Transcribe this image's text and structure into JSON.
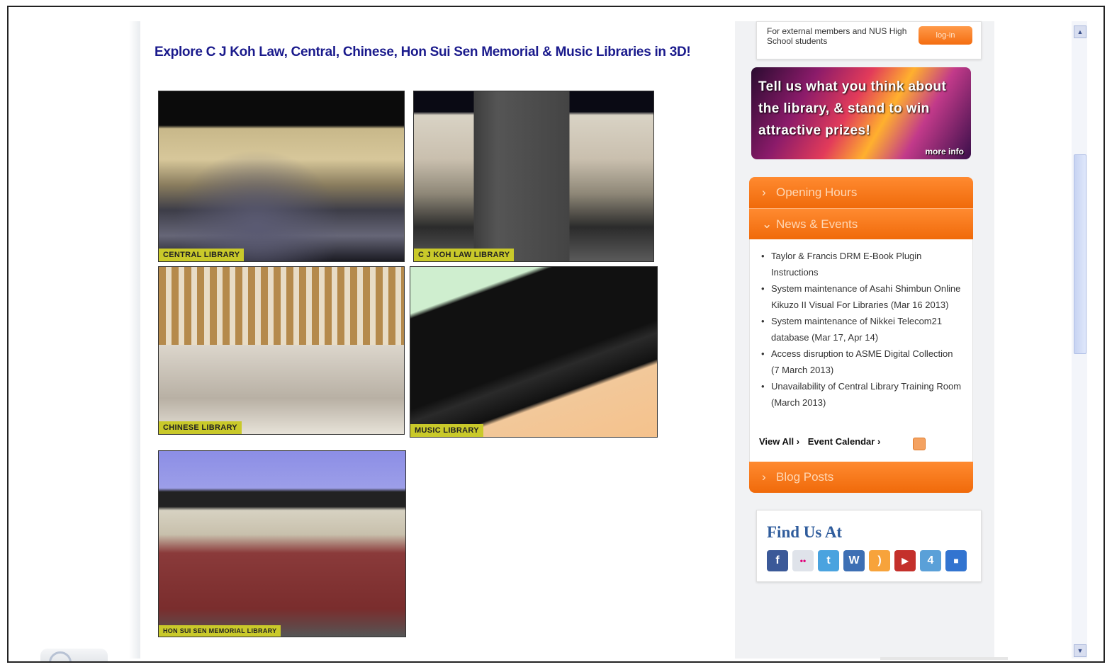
{
  "main": {
    "heading": "Explore C J Koh Law, Central, Chinese, Hon Sui Sen Memorial & Music Libraries in 3D!",
    "tiles": [
      {
        "label": "CENTRAL LIBRARY"
      },
      {
        "label": "C J KOH LAW LIBRARY"
      },
      {
        "label": "CHINESE LIBRARY"
      },
      {
        "label": "MUSIC LIBRARY"
      },
      {
        "label": "HON SUI SEN MEMORIAL LIBRARY"
      }
    ]
  },
  "sidebar": {
    "login_text": "For external members and NUS High School students",
    "login_button": "log-in",
    "promo_text": "Tell us what you think about the library, & stand to win attractive prizes!",
    "promo_more": "more info",
    "opening_hours": "Opening Hours",
    "news_events": "News & Events",
    "news_items": [
      "Taylor & Francis DRM E-Book Plugin Instructions",
      "System maintenance of Asahi Shimbun Online Kikuzo II Visual For Libraries (Mar 16 2013)",
      "System maintenance of Nikkei Telecom21 database (Mar 17, Apr 14)",
      "Access disruption to ASME Digital Collection (7 March 2013)",
      "Unavailability of Central Library Training Room (March 2013)"
    ],
    "view_all": "View All ›",
    "event_calendar": "Event Calendar ›",
    "blog_posts": "Blog Posts",
    "find_us": "Find Us At",
    "social": [
      {
        "icon": "facebook-icon",
        "glyph": "f",
        "color": "#3b5998"
      },
      {
        "icon": "flickr-icon",
        "glyph": "••",
        "color": "#dfe3ea"
      },
      {
        "icon": "twitter-icon",
        "glyph": "t",
        "color": "#4aa3df"
      },
      {
        "icon": "wordpress-icon",
        "glyph": "W",
        "color": "#3d6fb4"
      },
      {
        "icon": "rss-icon",
        "glyph": ")",
        "color": "#f7a33b"
      },
      {
        "icon": "youtube-icon",
        "glyph": "▶",
        "color": "#c4302b"
      },
      {
        "icon": "foursquare-icon",
        "glyph": "4",
        "color": "#5aa0d8"
      },
      {
        "icon": "delicious-icon",
        "glyph": "■",
        "color": "#3274d0"
      }
    ]
  },
  "scrollbar": {
    "up": "▲",
    "down": "▼"
  }
}
